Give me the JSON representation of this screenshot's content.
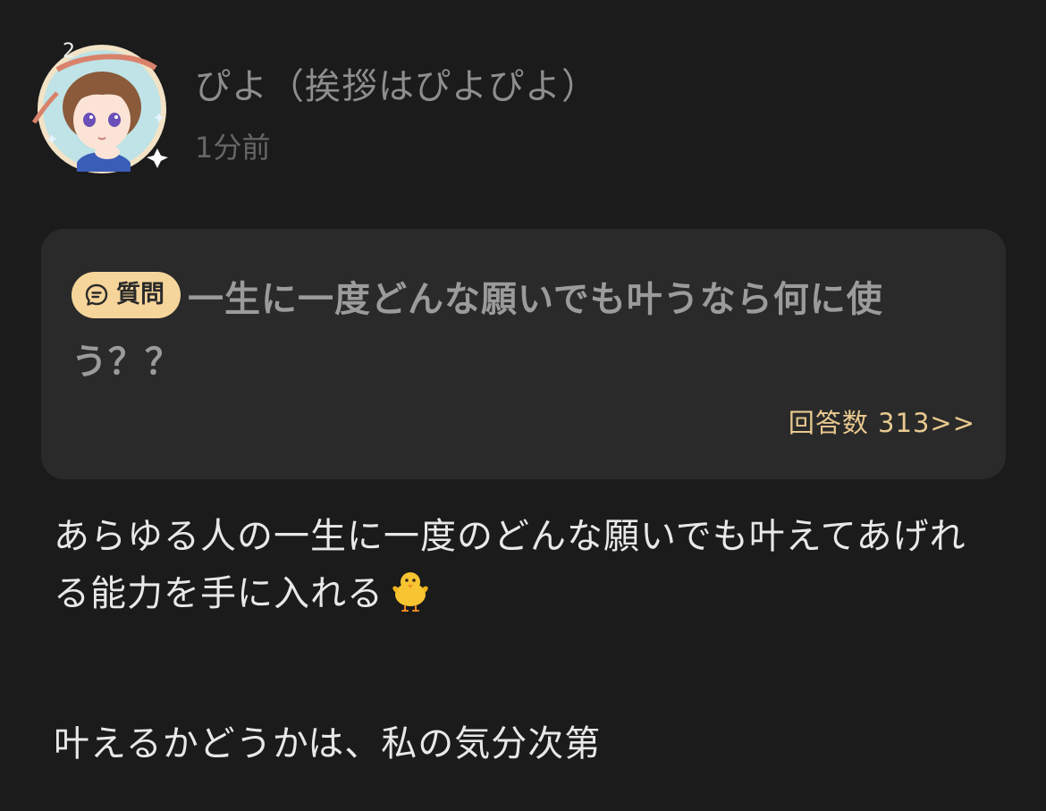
{
  "post": {
    "author_name": "ぴよ（挨拶はぴよぴよ）",
    "timestamp": "1分前",
    "avatar_icon": "anime-avatar-icon"
  },
  "question": {
    "badge_label": "質問",
    "badge_icon": "chat-bubble-icon",
    "text": "一生に一度どんな願いでも叶うなら何に使う？？",
    "answer_count_label": "回答数 313>>"
  },
  "answer": {
    "paragraph_1": "あらゆる人の一生に一度のどんな願いでも叶えてあげれる能力を手に入れる",
    "paragraph_1_emoji": "chick-emoji-icon",
    "paragraph_2": "叶えるかどうかは、私の気分次第"
  },
  "colors": {
    "background": "#1b1b1b",
    "card": "#2a2a2a",
    "badge": "#f6d59a",
    "accent_text": "#e9c98f"
  }
}
